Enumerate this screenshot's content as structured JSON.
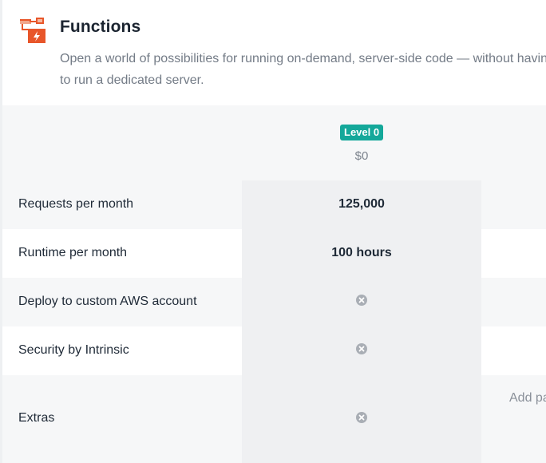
{
  "section": {
    "icon": "functions-icon",
    "title": "Functions",
    "description": "Open a world of possibilities for running on-demand, server-side code — without having to run a dedicated server."
  },
  "plan": {
    "badge": "Level 0",
    "price": "$0"
  },
  "rows": [
    {
      "label": "Requests per month",
      "value": "125,000"
    },
    {
      "label": "Runtime per month",
      "value": "100 hours"
    },
    {
      "label": "Deploy to custom AWS account",
      "value_icon": "not-included-icon"
    },
    {
      "label": "Security by Intrinsic",
      "value_icon": "not-included-icon"
    },
    {
      "label": "Extras",
      "value_icon": "not-included-icon"
    }
  ],
  "extras_link": "Add pa",
  "colors": {
    "badge": "#14a89a",
    "icon_accent": "#e8562a",
    "muted_text": "#737b86"
  }
}
